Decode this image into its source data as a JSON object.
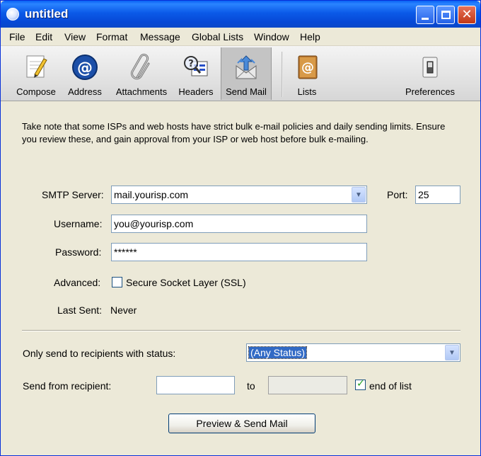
{
  "window": {
    "title": "untitled"
  },
  "menu": [
    "File",
    "Edit",
    "View",
    "Format",
    "Message",
    "Global Lists",
    "Window",
    "Help"
  ],
  "toolbar": {
    "compose": "Compose",
    "address": "Address",
    "attachments": "Attachments",
    "headers": "Headers",
    "send_mail": "Send Mail",
    "lists": "Lists",
    "preferences": "Preferences"
  },
  "info_text": "Take note that some ISPs and web hosts have strict bulk e-mail policies and daily sending limits. Ensure you review these, and gain approval from your ISP or web host before bulk e-mailing.",
  "form": {
    "smtp_label": "SMTP Server:",
    "smtp_value": "mail.yourisp.com",
    "port_label": "Port:",
    "port_value": "25",
    "username_label": "Username:",
    "username_value": "you@yourisp.com",
    "password_label": "Password:",
    "password_value": "******",
    "advanced_label": "Advanced:",
    "ssl_label": "Secure Socket Layer (SSL)",
    "last_sent_label": "Last Sent:",
    "last_sent_value": "Never",
    "status_label": "Only send to recipients with status:",
    "status_value": "(Any Status)",
    "from_label": "Send from recipient:",
    "from_value": "",
    "to_label": "to",
    "to_value": "",
    "end_of_list_label": "end of list",
    "preview_button": "Preview & Send Mail"
  }
}
